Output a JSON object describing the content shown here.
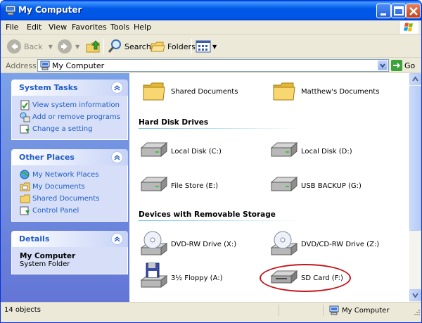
{
  "window": {
    "title": "My Computer",
    "icon": "my-computer-icon"
  },
  "menu": {
    "items": [
      "File",
      "Edit",
      "View",
      "Favorites",
      "Tools",
      "Help"
    ]
  },
  "toolbar": {
    "back_label": "Back",
    "search_label": "Search",
    "folders_label": "Folders"
  },
  "address": {
    "label": "Address",
    "value": "My Computer",
    "go_label": "Go"
  },
  "sidebar": {
    "system_tasks": {
      "title": "System Tasks",
      "items": [
        "View system information",
        "Add or remove programs",
        "Change a setting"
      ]
    },
    "other_places": {
      "title": "Other Places",
      "items": [
        "My Network Places",
        "My Documents",
        "Shared Documents",
        "Control Panel"
      ]
    },
    "details": {
      "title": "Details",
      "name": "My Computer",
      "subtitle": "System Folder"
    }
  },
  "content": {
    "folders": [
      "Shared Documents",
      "Matthew's Documents"
    ],
    "hard_disk_header": "Hard Disk Drives",
    "hard_disks": [
      "Local Disk (C:)",
      "Local Disk (D:)",
      "File Store (E:)",
      "USB BACKUP (G:)"
    ],
    "removable_header": "Devices with Removable Storage",
    "removable": [
      "DVD-RW Drive (X:)",
      "DVD/CD-RW Drive (Z:)",
      "3½ Floppy (A:)",
      "SD Card (F:)"
    ]
  },
  "status": {
    "count": "14 objects",
    "zone": "My Computer"
  },
  "colors": {
    "title_bar": "#0055e5",
    "task_pane": "#6375d6",
    "panel_title": "#215dc6",
    "highlight_ring": "#c4161c"
  }
}
